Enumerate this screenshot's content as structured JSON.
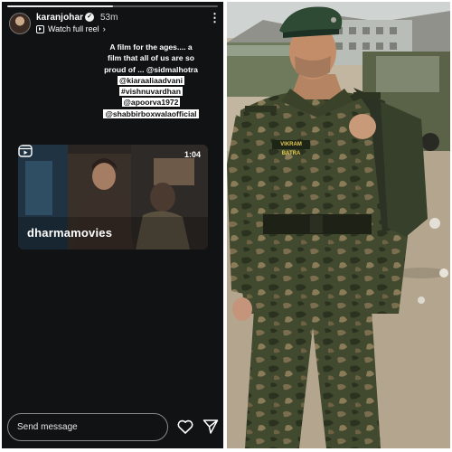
{
  "story": {
    "progress_fraction": 0.5,
    "username": "karanjohar",
    "verified_icon": "verified-badge-icon",
    "time_ago": "53m",
    "more_icon": "more-vertical-icon",
    "reel_link_label": "Watch full reel",
    "reel_link_icon": "reel-icon",
    "caption_lines": [
      "A film for the ages.... a",
      "film that all of us are so",
      "proud of ... @sidmalhotra",
      "@kiaraaliaadvani",
      "#vishnuvardhan",
      "@apoorva1972",
      "@shabbirboxwalaofficial"
    ],
    "reel": {
      "duration": "1:04",
      "brand": "dharmamovies",
      "icon": "reels-icon"
    },
    "message_placeholder": "Send message",
    "like_icon": "heart-icon",
    "share_icon": "send-icon"
  },
  "photo": {
    "name_tape": "VIKRAM BATRA"
  },
  "colors": {
    "story_bg": "#111214",
    "caption_highlight": "#ffffff",
    "uniform_green": "#3f4a2e"
  }
}
